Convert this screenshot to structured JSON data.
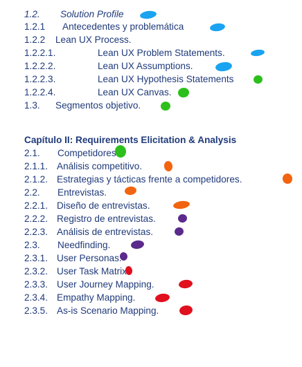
{
  "colors": {
    "text": "#1f3a7a",
    "marker_blue": "#1aa3f0",
    "marker_green": "#2dbf1c",
    "marker_orange": "#f2640f",
    "marker_purple": "#5b2a8c",
    "marker_red": "#e0101e"
  },
  "toc": {
    "entries": [
      {
        "num": "1.2.",
        "title": "Solution Profile",
        "marker": "blue"
      },
      {
        "num": "1.2.1",
        "title": "Antecedentes y problemática",
        "marker": "blue"
      },
      {
        "num": "1.2.2",
        "title": "Lean UX Process.",
        "marker": "none"
      },
      {
        "num": "1.2.2.1.",
        "title": "Lean UX Problem Statements.",
        "marker": "blue"
      },
      {
        "num": "1.2.2.2.",
        "title": "Lean UX Assumptions.",
        "marker": "blue"
      },
      {
        "num": "1.2.2.3.",
        "title": "Lean UX Hypothesis Statements",
        "marker": "green"
      },
      {
        "num": "1.2.2.4.",
        "title": "Lean UX Canvas.",
        "marker": "green"
      },
      {
        "num": "1.3.",
        "title": "Segmentos objetivo.",
        "marker": "green"
      },
      {
        "num": "",
        "title": "Capítulo II: Requirements Elicitation & Analysis",
        "marker": "none"
      },
      {
        "num": "2.1.",
        "title": "Competidores.",
        "marker": "green"
      },
      {
        "num": "2.1.1.",
        "title": "Análisis competitivo.",
        "marker": "orange"
      },
      {
        "num": "2.1.2.",
        "title": "Estrategias y tácticas frente a competidores.",
        "marker": "orange"
      },
      {
        "num": "2.2.",
        "title": "Entrevistas.",
        "marker": "orange"
      },
      {
        "num": "2.2.1.",
        "title": "Diseño de entrevistas.",
        "marker": "orange"
      },
      {
        "num": "2.2.2.",
        "title": "Registro de entrevistas.",
        "marker": "purple"
      },
      {
        "num": "2.2.3.",
        "title": "Análisis de entrevistas.",
        "marker": "purple"
      },
      {
        "num": "2.3.",
        "title": "Needfinding.",
        "marker": "purple"
      },
      {
        "num": "2.3.1.",
        "title": "User Personas.",
        "marker": "purple"
      },
      {
        "num": "2.3.2.",
        "title": "User Task Matrix.",
        "marker": "red"
      },
      {
        "num": "2.3.3.",
        "title": "User Journey Mapping.",
        "marker": "red"
      },
      {
        "num": "2.3.4.",
        "title": "Empathy Mapping.",
        "marker": "red"
      },
      {
        "num": "2.3.5.",
        "title": "As-is Scenario Mapping.",
        "marker": "red"
      }
    ]
  }
}
